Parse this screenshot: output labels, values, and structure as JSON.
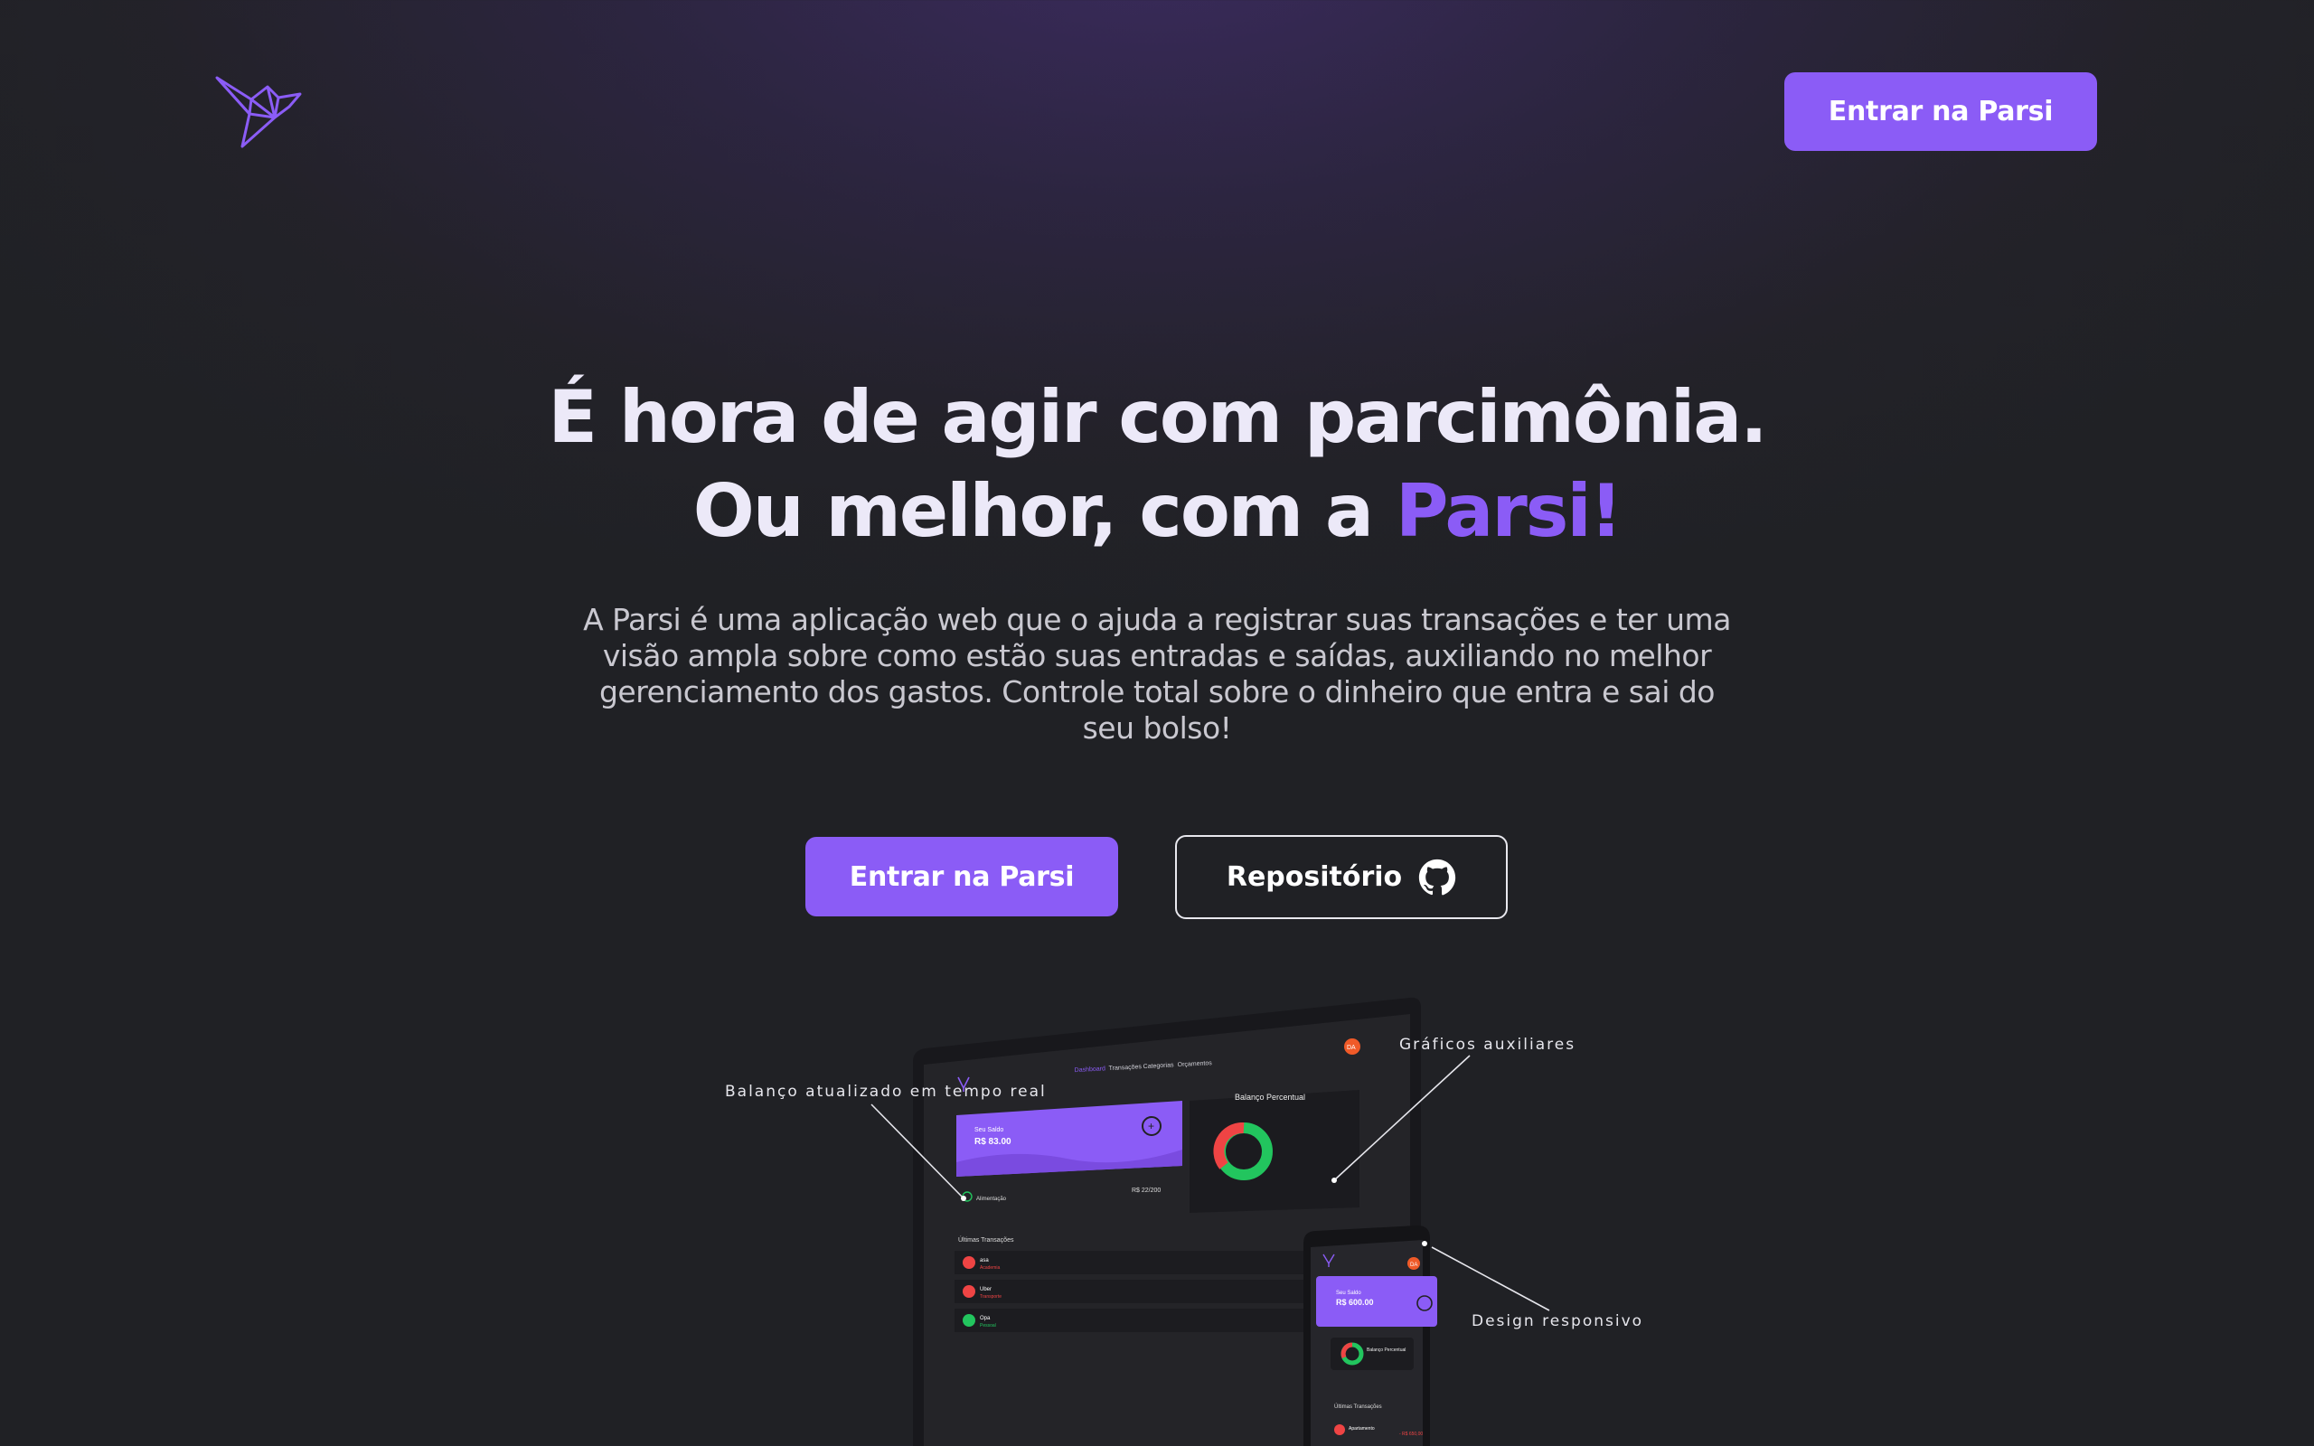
{
  "header": {
    "logo_icon": "origami-bird-icon",
    "cta_label": "Entrar na Parsi"
  },
  "hero": {
    "title_line1": "É hora de agir com parcimônia.",
    "title_line2_prefix": "Ou melhor, com a ",
    "title_line2_accent": "Parsi!",
    "description": "A Parsi é uma aplicação web que o ajuda a registrar suas transações e ter uma visão ampla sobre como estão suas entradas e saídas, auxiliando no melhor gerenciamento dos gastos. Controle total sobre o dinheiro que entra e sai do seu bolso!",
    "primary_cta": "Entrar na Parsi",
    "secondary_cta": "Repositório",
    "secondary_icon": "github-icon"
  },
  "showcase": {
    "annotations": {
      "balance": "Balanço atualizado em tempo real",
      "charts": "Gráficos auxiliares",
      "responsive": "Design responsivo"
    },
    "desktop": {
      "nav": [
        "Dashboard",
        "Transações",
        "Categorias",
        "Orçamentos"
      ],
      "avatar": "DA",
      "balance_label": "Seu Saldo",
      "balance_value": "R$ 83.00",
      "budget_category": "Alimentação",
      "budget_value": "R$ 22/200",
      "chart_title": "Balanço Percentual",
      "transactions_title": "Últimas Transações",
      "transactions": [
        {
          "name": "asa",
          "tag": "Academia"
        },
        {
          "name": "Uber",
          "tag": "Transporte"
        },
        {
          "name": "Opa",
          "tag": "Pessoal"
        }
      ]
    },
    "mobile": {
      "avatar": "DA",
      "balance_label": "Seu Saldo",
      "balance_value": "R$ 600.00",
      "chart_title": "Balanço Percentual",
      "transactions_title": "Últimas Transações",
      "transaction_name": "Apartamento",
      "transaction_value": "- R$ 650,00"
    }
  },
  "colors": {
    "accent": "#8b5cf6",
    "background": "#212126",
    "positive": "#22c55e",
    "negative": "#ef4444"
  }
}
